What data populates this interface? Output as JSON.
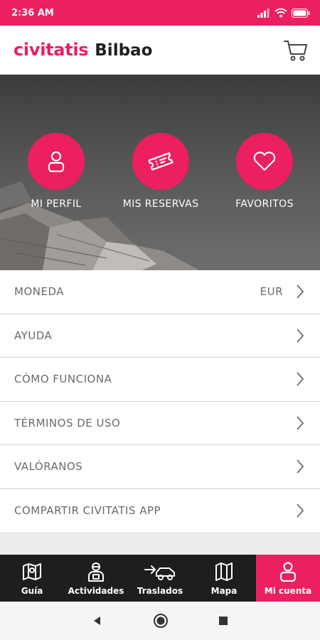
{
  "status": {
    "time": "2:36 AM"
  },
  "header": {
    "logo": "civitatis",
    "city": "Bilbao"
  },
  "hero": {
    "buttons": [
      {
        "label": "MI PERFIL",
        "icon": "user-icon"
      },
      {
        "label": "MIS RESERVAS",
        "icon": "ticket-icon"
      },
      {
        "label": "FAVORITOS",
        "icon": "heart-icon"
      }
    ]
  },
  "menu": {
    "items": [
      {
        "label": "MONEDA",
        "value": "EUR"
      },
      {
        "label": "AYUDA"
      },
      {
        "label": "CÓMO FUNCIONA"
      },
      {
        "label": "TÉRMINOS DE USO"
      },
      {
        "label": "VALÓRANOS"
      },
      {
        "label": "COMPARTIR CIVITATIS APP"
      }
    ]
  },
  "tabbar": {
    "tabs": [
      {
        "label": "Guía",
        "icon": "book-map-icon"
      },
      {
        "label": "Actividades",
        "icon": "guide-person-icon"
      },
      {
        "label": "Traslados",
        "icon": "car-transfer-icon"
      },
      {
        "label": "Mapa",
        "icon": "map-icon"
      },
      {
        "label": "Mi cuenta",
        "icon": "user-icon",
        "active": true
      }
    ]
  },
  "colors": {
    "brand": "#ec1f5f",
    "tabbar": "#1e1e1e"
  }
}
